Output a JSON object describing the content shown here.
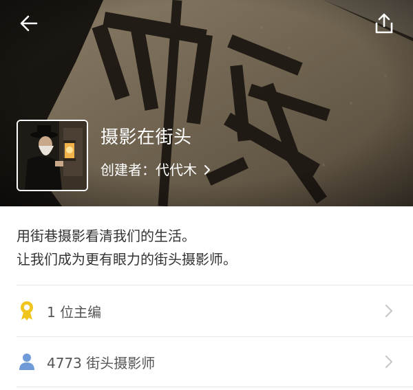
{
  "header": {
    "title": "摄影在街头",
    "creator_text": "创建者：代代木"
  },
  "description": {
    "lines": [
      "用街巷摄影看清我们的生活。",
      "让我们成为更有眼力的街头摄影师。"
    ]
  },
  "rows": [
    {
      "label": "1 位主编",
      "icon": "award-badge-icon"
    },
    {
      "label": "4773 街头摄影师",
      "icon": "person-icon"
    }
  ],
  "colors": {
    "badge": "#f0c51d",
    "person": "#6f9bd8",
    "divider": "#e6e6e6",
    "chevron": "#c7c7cc"
  }
}
